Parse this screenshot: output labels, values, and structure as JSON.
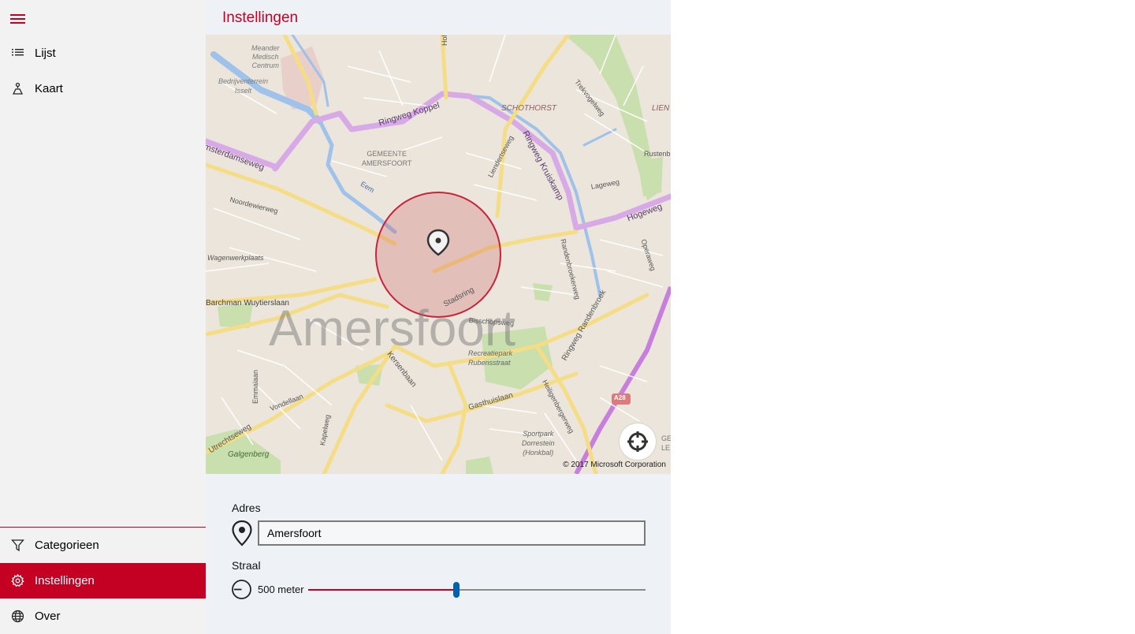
{
  "sidebar": {
    "menu_label": "Menu",
    "top_items": [
      {
        "label": "Lijst",
        "icon": "list-icon"
      },
      {
        "label": "Kaart",
        "icon": "map-pin-person-icon"
      }
    ],
    "bottom_items": [
      {
        "label": "Categorieen",
        "icon": "filter-icon"
      },
      {
        "label": "Instellingen",
        "icon": "gear-icon",
        "active": true
      },
      {
        "label": "Over",
        "icon": "globe-icon"
      }
    ]
  },
  "page": {
    "title": "Instellingen"
  },
  "map": {
    "city_label": "Amersfoort",
    "copyright": "© 2017 Microsoft Corporation",
    "labels": {
      "meander": "Meander",
      "medisch": "Medisch",
      "centrum": "Centrum",
      "bedrijf": "Bedrijventerrein",
      "isselt": "Isselt",
      "holkerweg": "Holkerw",
      "trekvogelweg": "Trekvogelweg",
      "schothorst": "SCHOTHORST",
      "lien": "LIEN",
      "ringweg_koppel": "Ringweg Koppel",
      "amsterdamseweg": "msterdamseweg",
      "gemeente": "GEMEENTE",
      "amersfoort_caps": "AMERSFOORT",
      "liendertseweg": "Liendertseweg",
      "ringweg_kruiskamp": "Ringweg Kruiskamp",
      "rustenb": "Rustenb",
      "lageweg": "Lageweg",
      "eem": "Eem",
      "hogeweg": "Hogeweg",
      "noordewierweg": "Noordewierweg",
      "wagenwerkplaats": "Wagenwerkplaats",
      "operaweg": "Operaweg",
      "randenbroekerweg": "Randenbroekerweg",
      "ringweg_randenbroek": "Ringweg Randenbroek",
      "stadsring": "Stadsring",
      "barchman": "Barchman Wuytierslaan",
      "bisschopsweg": "Bisschopsweg",
      "recreatiepark": "Recreatiepark",
      "rubensstraat": "Rubensstraat",
      "kersenbaan": "Kersenbaan",
      "heiligenbergerweg": "Heiligenbergerweg",
      "gasthuislaan": "Gasthuislaan",
      "a28": "A28",
      "emmalaan": "Emmalaan",
      "vondellaan": "Vondellaan",
      "kapelweg": "Kapelweg",
      "utrechtseweg": "Utrechtseweg",
      "galgenberg": "Galgenberg",
      "sportpark": "Sportpark",
      "dorrestein": "Dorrestein",
      "honkbal": "(Honkbal)",
      "ge": "GE",
      "le": "LE"
    }
  },
  "form": {
    "address_label": "Adres",
    "address_value": "Amersfoort",
    "radius_label": "Straal",
    "radius_value_text": "500 meter",
    "radius_fraction": 0.44
  },
  "colors": {
    "accent": "#c40023",
    "slider_thumb": "#0063b1",
    "ringweg": "#d9a6e8",
    "water": "#9cc0e8",
    "park": "#c7deaa"
  }
}
